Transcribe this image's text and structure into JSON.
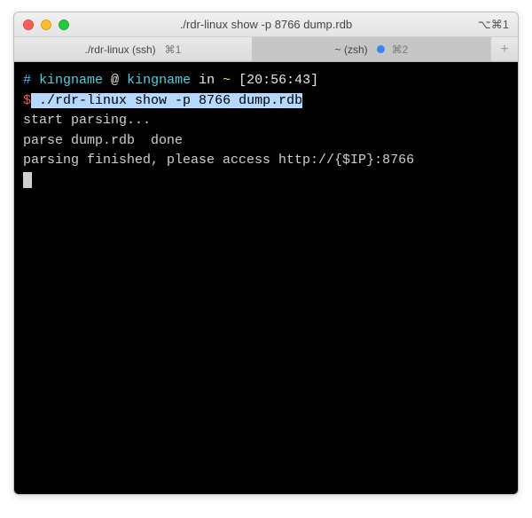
{
  "window": {
    "title": "./rdr-linux show -p 8766 dump.rdb",
    "title_shortcut": "⌥⌘1"
  },
  "tabs": {
    "items": [
      {
        "label": "./rdr-linux (ssh)",
        "shortcut": "⌘1",
        "active": false
      },
      {
        "label": "~ (zsh)",
        "shortcut": "⌘2",
        "active": true,
        "dot": true
      }
    ]
  },
  "prompt": {
    "hash": "#",
    "user1": "kingname",
    "at": " @ ",
    "user2": "kingname",
    "in": " in ",
    "dir": "~",
    "time": " [20:56:43]",
    "dollar": "$",
    "command_space": " ",
    "command": "./rdr-linux show -p 8766 dump.rdb"
  },
  "output": {
    "line1": "start parsing...",
    "line2": "parse dump.rdb  done",
    "line3": "parsing finished, please access http://{$IP}:8766"
  }
}
